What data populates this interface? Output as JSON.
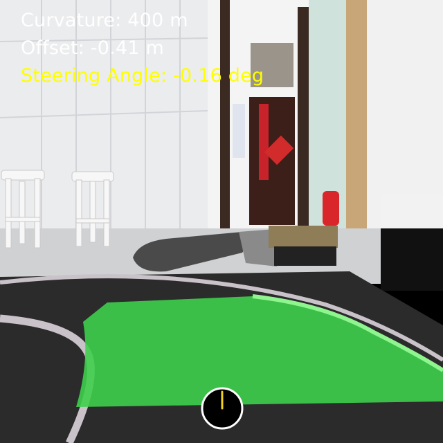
{
  "hud": {
    "curvature_label": "Curvature: 400 m",
    "offset_label": "Offset: -0.41 m",
    "steering_label": "Steering Angle: -0.16 deg",
    "curvature_m": 400,
    "offset_m": -0.41,
    "steering_deg": -0.16
  },
  "colors": {
    "hud_text": "#ffffff",
    "steering_text": "#ffff00",
    "lane_overlay": "#3ecf4c",
    "track_mat": "#2b2b2b",
    "track_line": "#c9c2c8",
    "compass_needle": "#f2d21a"
  },
  "icons": {
    "steering_indicator": "steering-dial-icon"
  }
}
